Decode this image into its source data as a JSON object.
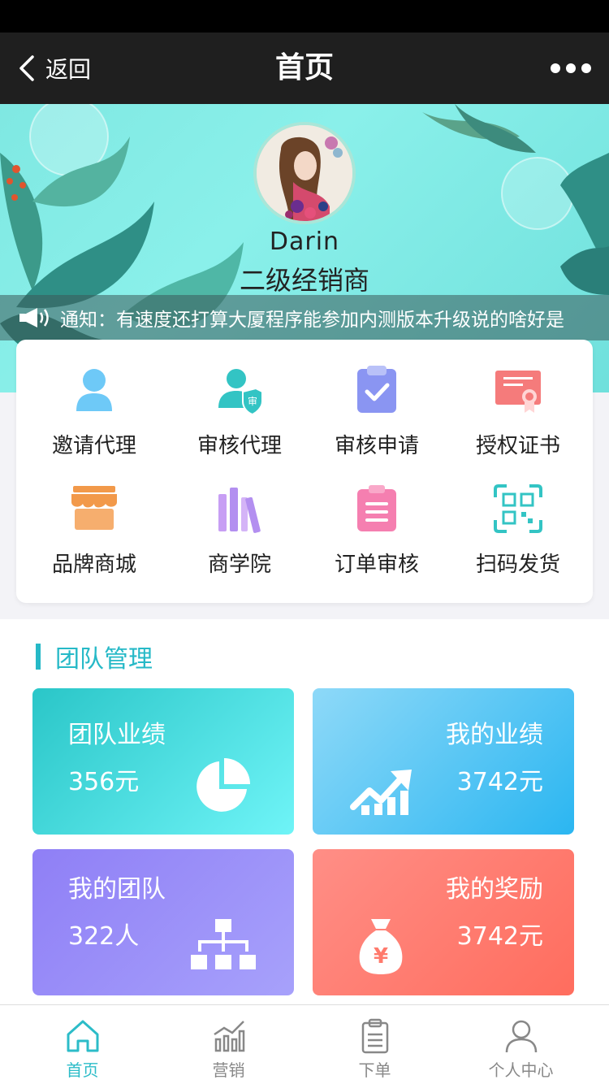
{
  "nav": {
    "back_label": "返回",
    "title": "首页"
  },
  "profile": {
    "name": "Darin",
    "role": "二级经销商"
  },
  "notice": {
    "text": "通知：有速度还打算大厦程序能参加内测版本升级说的啥好是"
  },
  "grid": [
    {
      "label": "邀请代理",
      "icon": "person-icon"
    },
    {
      "label": "审核代理",
      "icon": "agent-review-icon"
    },
    {
      "label": "审核申请",
      "icon": "clipboard-check-icon"
    },
    {
      "label": "授权证书",
      "icon": "certificate-icon"
    },
    {
      "label": "品牌商城",
      "icon": "store-icon"
    },
    {
      "label": "商学院",
      "icon": "books-icon"
    },
    {
      "label": "订单审核",
      "icon": "order-list-icon"
    },
    {
      "label": "扫码发货",
      "icon": "qr-scan-icon"
    }
  ],
  "team": {
    "title": "团队管理",
    "cards": [
      {
        "title": "团队业绩",
        "value": "356元",
        "icon": "pie-chart-icon"
      },
      {
        "title": "我的业绩",
        "value": "3742元",
        "icon": "trend-up-icon"
      },
      {
        "title": "我的团队",
        "value": "322人",
        "icon": "org-chart-icon"
      },
      {
        "title": "我的奖励",
        "value": "3742元",
        "icon": "money-bag-icon"
      }
    ]
  },
  "tabs": [
    {
      "label": "首页",
      "icon": "home-icon",
      "active": true
    },
    {
      "label": "营销",
      "icon": "bar-chart-icon",
      "active": false
    },
    {
      "label": "下单",
      "icon": "clipboard-icon",
      "active": false
    },
    {
      "label": "个人中心",
      "icon": "user-icon",
      "active": false
    }
  ],
  "colors": {
    "accent": "#2cbcc8",
    "nav_bg": "#1f1f1f"
  }
}
